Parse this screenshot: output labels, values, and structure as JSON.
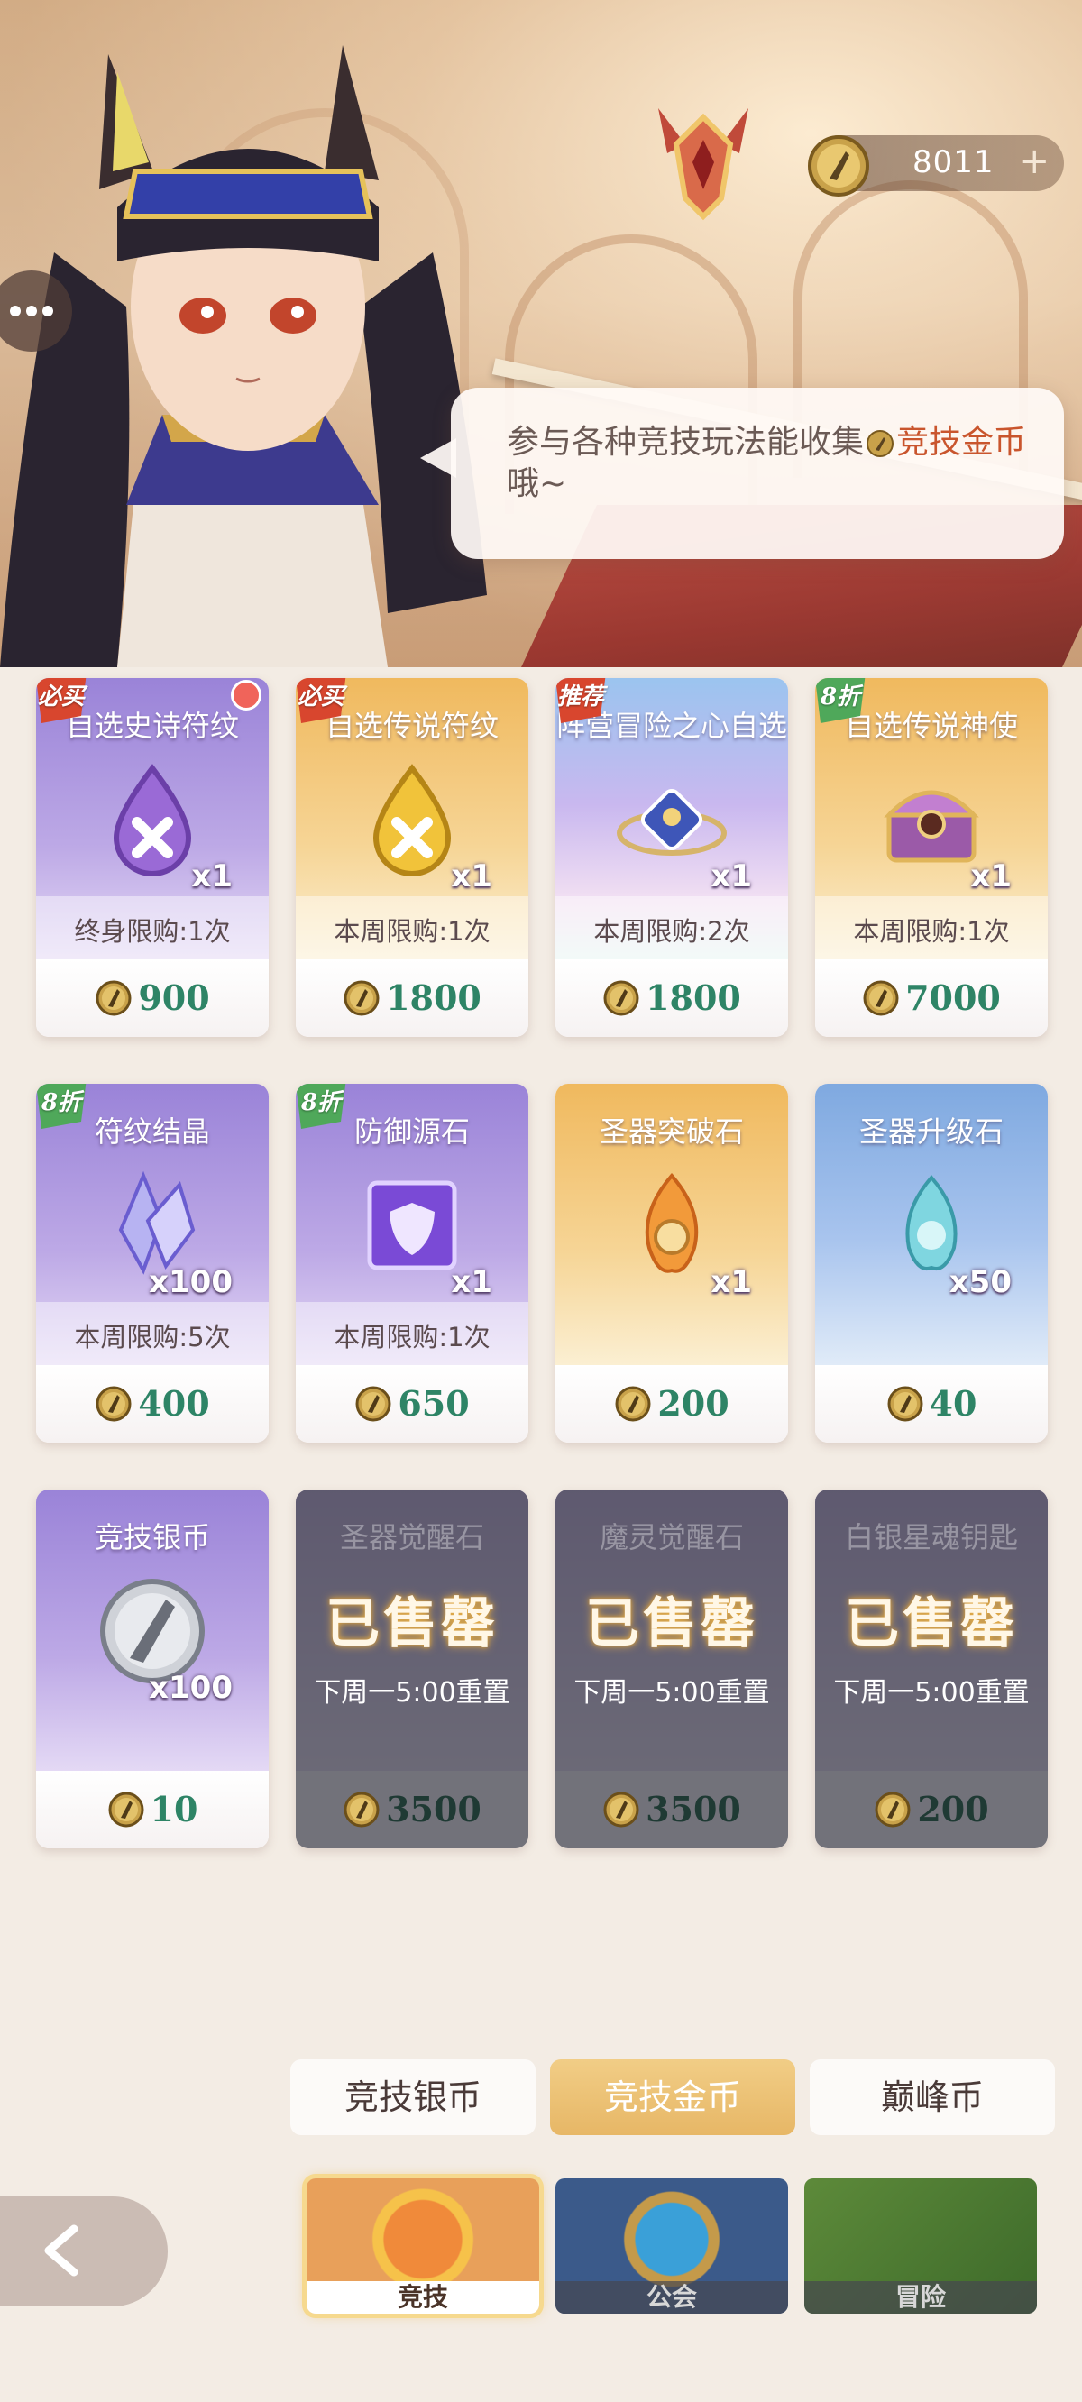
{
  "header": {
    "currency_value": "8011",
    "add_icon": "plus-icon"
  },
  "dialog": {
    "text_before": "参与各种竞技玩法能收集",
    "highlight": "竞技金币",
    "text_after": "哦~"
  },
  "shop_items": [
    {
      "name": "自选史诗符纹",
      "tag": "必买",
      "qty": "x1",
      "limit": "终身限购:1次",
      "price": "900",
      "theme": "purple",
      "icon": "epic-rune-icon",
      "badge_dot": true
    },
    {
      "name": "自选传说符纹",
      "tag": "必买",
      "qty": "x1",
      "limit": "本周限购:1次",
      "price": "1800",
      "theme": "gold",
      "icon": "legend-rune-icon"
    },
    {
      "name": "阵营冒险之心自选",
      "tag": "推荐",
      "qty": "x1",
      "limit": "本周限购:2次",
      "price": "1800",
      "theme": "holo",
      "icon": "adventure-heart-icon"
    },
    {
      "name": "自选传说神使",
      "tag": "8折",
      "qty": "x1",
      "limit": "本周限购:1次",
      "price": "7000",
      "theme": "gold",
      "icon": "treasure-chest-icon"
    },
    {
      "name": "符纹结晶",
      "tag": "8折",
      "qty": "x100",
      "limit": "本周限购:5次",
      "price": "400",
      "theme": "purple",
      "icon": "crystal-icon"
    },
    {
      "name": "防御源石",
      "tag": "8折",
      "qty": "x1",
      "limit": "本周限购:1次",
      "price": "650",
      "theme": "purple",
      "icon": "defense-stone-icon"
    },
    {
      "name": "圣器突破石",
      "tag": "",
      "qty": "x1",
      "limit": "",
      "price": "200",
      "theme": "gold",
      "icon": "breakthrough-stone-icon"
    },
    {
      "name": "圣器升级石",
      "tag": "",
      "qty": "x50",
      "limit": "",
      "price": "40",
      "theme": "blue",
      "icon": "upgrade-stone-icon"
    },
    {
      "name": "竞技银币",
      "tag": "",
      "qty": "x100",
      "limit": "",
      "price": "10",
      "theme": "purple",
      "icon": "silver-coin-icon"
    },
    {
      "name": "圣器觉醒石",
      "sold": "已售罄",
      "reset": "下周一5:00重置",
      "price": "3500",
      "theme": "soldout"
    },
    {
      "name": "魔灵觉醒石",
      "sold": "已售罄",
      "reset": "下周一5:00重置",
      "price": "3500",
      "theme": "soldout"
    },
    {
      "name": "白银星魂钥匙",
      "sold": "已售罄",
      "reset": "下周一5:00重置",
      "price": "200",
      "theme": "soldout"
    }
  ],
  "currency_tabs": [
    {
      "label": "竞技银币",
      "active": false
    },
    {
      "label": "竞技金币",
      "active": true
    },
    {
      "label": "巅峰币",
      "active": false
    }
  ],
  "categories": [
    {
      "label": "竞技",
      "active": true
    },
    {
      "label": "公会",
      "active": false
    },
    {
      "label": "冒险",
      "active": false
    }
  ],
  "colors": {
    "price_green": "#2e8466",
    "highlight_orange": "#c9552d",
    "active_tab": "#e7b766"
  }
}
